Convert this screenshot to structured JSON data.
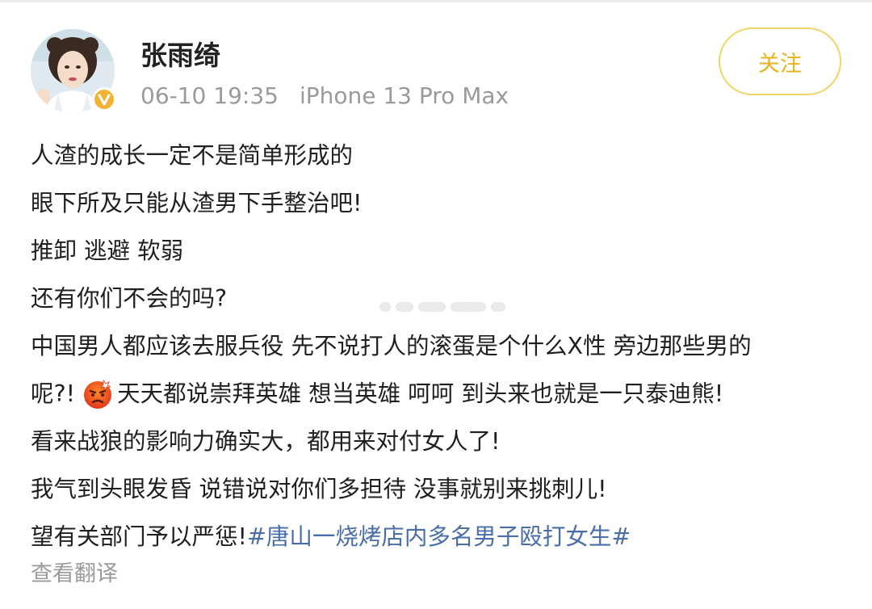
{
  "user": {
    "name": "张雨绮",
    "verified": true
  },
  "meta": {
    "time": "06-10 19:35",
    "device": "iPhone 13 Pro Max"
  },
  "actions": {
    "follow_label": "关注"
  },
  "post": {
    "line1": "人渣的成长一定不是简单形成的",
    "line2": "眼下所及只能从渣男下手整治吧!",
    "line3": "推卸 逃避 软弱",
    "line4": "还有你们不会的吗?",
    "line5": "中国男人都应该去服兵役 先不说打人的滚蛋是个什么X性 旁边那些男的",
    "line6_before": "呢?!",
    "line6_after": "天天都说崇拜英雄 想当英雄 呵呵 到头来也就是一只泰迪熊!",
    "line7": "看来战狼的影响力确实大，都用来对付女人了!",
    "line8": "我气到头眼发昏 说错说对你们多担待 没事就别来挑刺儿!",
    "line9_text": "望有关部门予以严惩!",
    "line9_hashtag": "#唐山一烧烤店内多名男子殴打女生#"
  },
  "translate_label": "查看翻译",
  "colors": {
    "follow_text": "#e7b31d",
    "follow_border": "#f0d56a",
    "hashtag": "#4a6ea8",
    "meta_text": "#9a9a9a",
    "verified_badge": "#f2b233"
  },
  "icons": {
    "emoji": "angry-face-icon",
    "verified": "verified-badge-icon"
  }
}
